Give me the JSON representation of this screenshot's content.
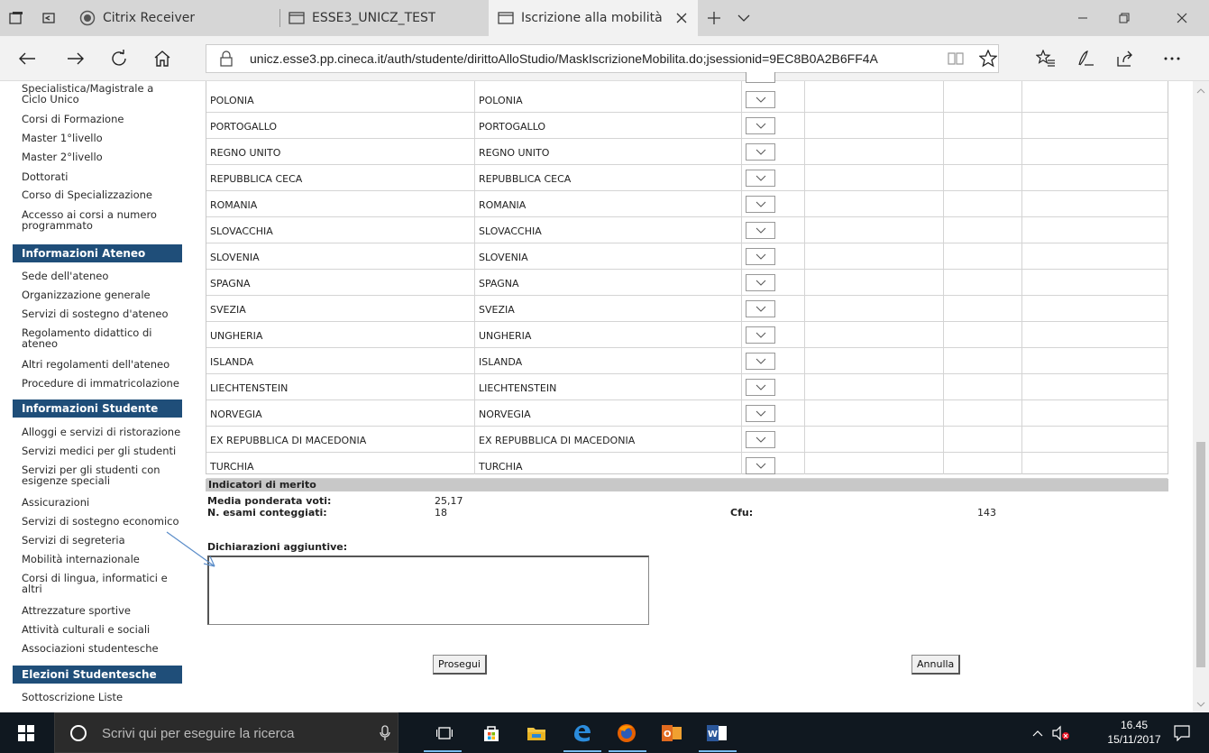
{
  "tabs": [
    {
      "label": "Citrix Receiver"
    },
    {
      "label": "ESSE3_UNICZ_TEST"
    },
    {
      "label": "Iscrizione alla mobilità"
    }
  ],
  "address": {
    "url": "unicz.esse3.pp.cineca.it/auth/studente/dirittoAlloStudio/MaskIscrizioneMobilita.do;jsessionid=9EC8B0A2B6FF4A"
  },
  "sidebar": {
    "items_top": [
      {
        "label": "Specialistica/Magistrale a"
      },
      {
        "label": "Ciclo Unico"
      },
      {
        "label": "Corsi di Formazione"
      },
      {
        "label": "Master 1°livello"
      },
      {
        "label": "Master 2°livello"
      },
      {
        "label": "Dottorati"
      },
      {
        "label": "Corso di Specializzazione"
      },
      {
        "label": "Accesso ai corsi a numero"
      },
      {
        "label": "programmato"
      }
    ],
    "section_ateneo": "Informazioni Ateneo",
    "items_ateneo": [
      {
        "label": "Sede dell'ateneo"
      },
      {
        "label": "Organizzazione generale"
      },
      {
        "label": "Servizi di sostegno d'ateneo"
      },
      {
        "label": "Regolamento didattico di"
      },
      {
        "label": "ateneo"
      },
      {
        "label": "Altri regolamenti dell'ateneo"
      },
      {
        "label": "Procedure di immatricolazione"
      }
    ],
    "section_studente": "Informazioni Studente",
    "items_studente": [
      {
        "label": "Alloggi e servizi di ristorazione"
      },
      {
        "label": "Servizi medici per gli studenti"
      },
      {
        "label": "Servizi per gli studenti con"
      },
      {
        "label": "esigenze speciali"
      },
      {
        "label": "Assicurazioni"
      },
      {
        "label": "Servizi di sostegno economico"
      },
      {
        "label": "Servizi di segreteria"
      },
      {
        "label": "Mobilità internazionale"
      },
      {
        "label": "Corsi di lingua, informatici e"
      },
      {
        "label": "altri"
      },
      {
        "label": "Attrezzature sportive"
      },
      {
        "label": "Attività culturali e sociali"
      },
      {
        "label": "Associazioni studentesche"
      }
    ],
    "section_elezioni": "Elezioni Studentesche",
    "items_elezioni": [
      {
        "label": "Sottoscrizione Liste"
      }
    ]
  },
  "countries": [
    {
      "c1": "POLONIA",
      "c2": "POLONIA"
    },
    {
      "c1": "PORTOGALLO",
      "c2": "PORTOGALLO"
    },
    {
      "c1": "REGNO UNITO",
      "c2": "REGNO UNITO"
    },
    {
      "c1": "REPUBBLICA CECA",
      "c2": "REPUBBLICA CECA"
    },
    {
      "c1": "ROMANIA",
      "c2": "ROMANIA"
    },
    {
      "c1": "SLOVACCHIA",
      "c2": "SLOVACCHIA"
    },
    {
      "c1": "SLOVENIA",
      "c2": "SLOVENIA"
    },
    {
      "c1": "SPAGNA",
      "c2": "SPAGNA"
    },
    {
      "c1": "SVEZIA",
      "c2": "SVEZIA"
    },
    {
      "c1": "UNGHERIA",
      "c2": "UNGHERIA"
    },
    {
      "c1": "ISLANDA",
      "c2": "ISLANDA"
    },
    {
      "c1": "LIECHTENSTEIN",
      "c2": "LIECHTENSTEIN"
    },
    {
      "c1": "NORVEGIA",
      "c2": "NORVEGIA"
    },
    {
      "c1": "EX REPUBBLICA DI MACEDONIA",
      "c2": "EX REPUBBLICA DI MACEDONIA"
    },
    {
      "c1": "TURCHIA",
      "c2": "TURCHIA"
    }
  ],
  "merit": {
    "header": "Indicatori di merito",
    "media_label": "Media ponderata voti:",
    "media_value": "25,17",
    "esami_label": "N. esami conteggiati:",
    "esami_value": "18",
    "cfu_label": "Cfu:",
    "cfu_value": "143"
  },
  "form": {
    "dichiarazioni_label": "Dichiarazioni aggiuntive:",
    "prosegui_label": "Prosegui",
    "annulla_label": "Annulla"
  },
  "taskbar": {
    "search_placeholder": "Scrivi qui per eseguire la ricerca",
    "time": "16.45",
    "date": "15/11/2017"
  }
}
